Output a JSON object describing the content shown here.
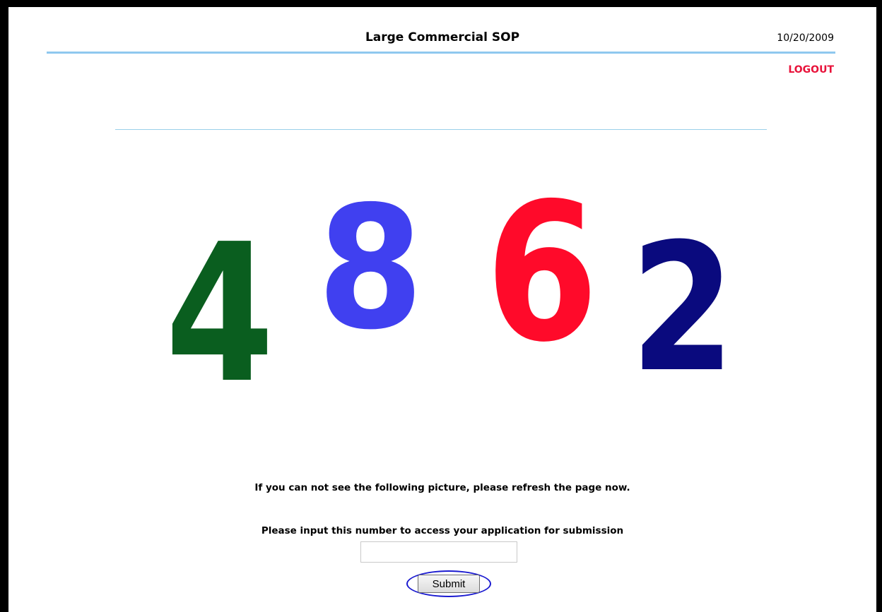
{
  "header": {
    "title": "Large Commercial SOP",
    "date": "10/20/2009",
    "logout_label": "LOGOUT"
  },
  "captcha": {
    "digits": [
      {
        "value": "4",
        "color": "#0a5e1f"
      },
      {
        "value": "8",
        "color": "#4040f0"
      },
      {
        "value": "6",
        "color": "#ff0a2a"
      },
      {
        "value": "2",
        "color": "#0a0a7e"
      }
    ]
  },
  "form": {
    "warning_text": "If you can not see the following picture, please refresh the page now.",
    "prompt_text": "Please input this number to access your application for submission",
    "code_value": "",
    "submit_label": "Submit"
  },
  "colors": {
    "rule": "#8fc8ef",
    "logout": "#e8123a",
    "highlight_ring": "#1a1ad0"
  }
}
